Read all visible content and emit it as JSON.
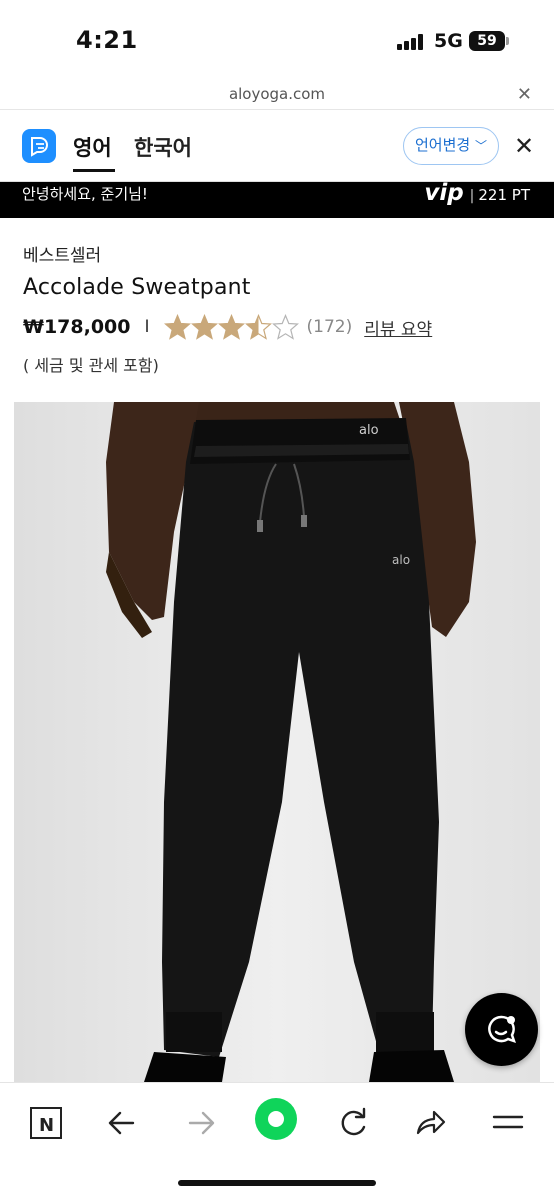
{
  "status_bar": {
    "time": "4:21",
    "network": "5G",
    "battery": "59"
  },
  "browser": {
    "url": "aloyoga.com"
  },
  "translation_bar": {
    "tab_source": "영어",
    "tab_target": "한국어",
    "change_language_label": "언어변경",
    "accent_color": "#1e8fff"
  },
  "greeting": {
    "text": "안녕하세요, 준기님!",
    "vip_label": "vip",
    "points": "221 PT"
  },
  "product": {
    "category": "베스트셀러",
    "name": "Accolade Sweatpant",
    "price": "₩178,000",
    "separator": "I",
    "rating": 3.5,
    "rating_max": 5,
    "review_count": "(172)",
    "review_summary_link": "리뷰 요약",
    "tax_note": "( 세금 및 관세 포함)",
    "image_logo_text": "alo"
  },
  "toolbar_icons": [
    "n-icon",
    "back-arrow-icon",
    "forward-arrow-icon",
    "home-record-icon",
    "reload-icon",
    "share-icon",
    "menu-icon"
  ]
}
